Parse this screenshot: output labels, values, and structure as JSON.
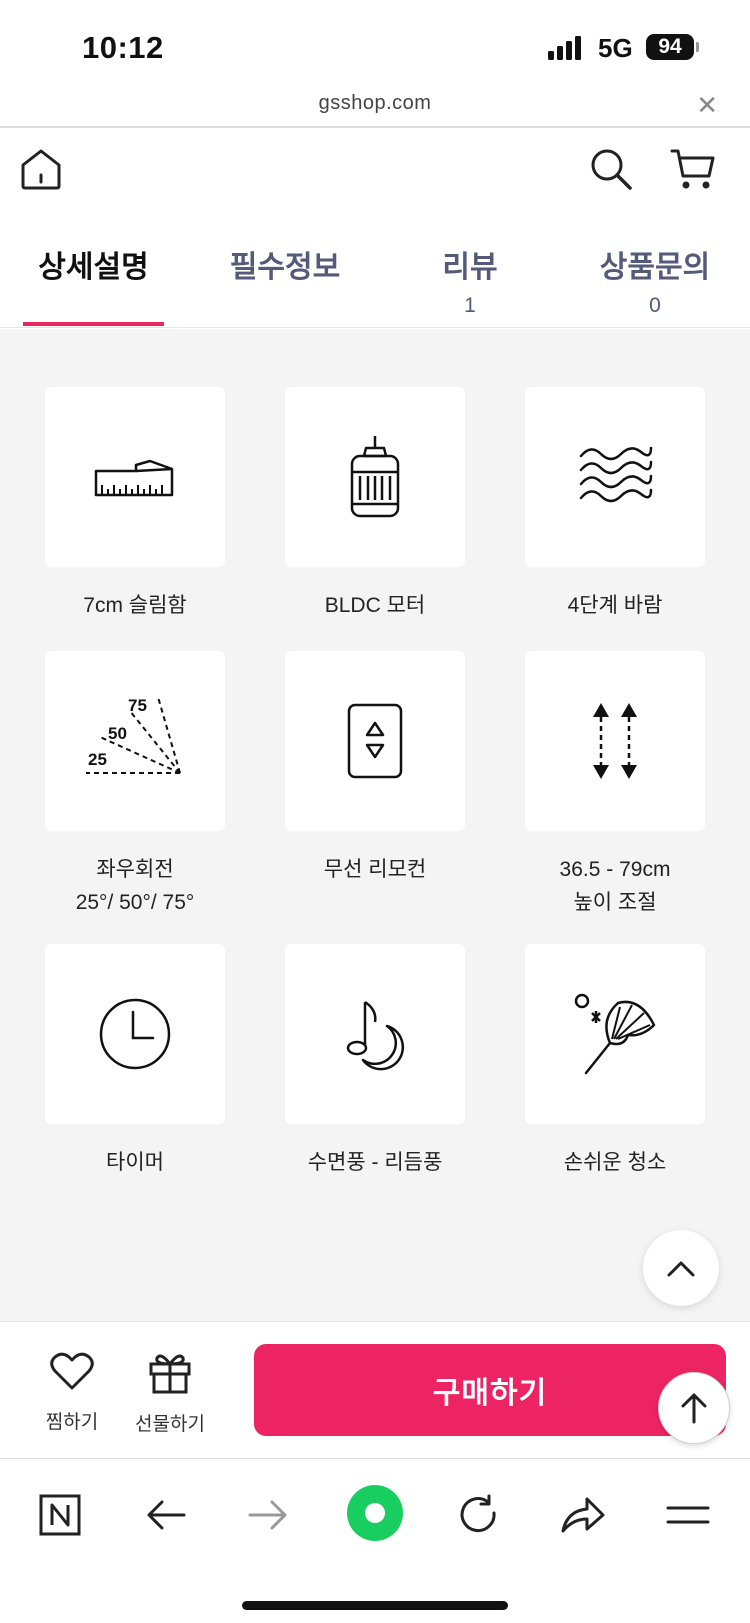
{
  "status": {
    "time": "10:12",
    "network": "5G",
    "battery": "94"
  },
  "browser": {
    "url": "gsshop.com"
  },
  "tabs": [
    {
      "label": "상세설명",
      "count": ""
    },
    {
      "label": "필수정보",
      "count": ""
    },
    {
      "label": "리뷰",
      "count": "1"
    },
    {
      "label": "상품문의",
      "count": "0"
    }
  ],
  "features": [
    {
      "icon": "ruler-icon",
      "line1": "7cm 슬림함",
      "line2": ""
    },
    {
      "icon": "motor-icon",
      "line1": "BLDC 모터",
      "line2": ""
    },
    {
      "icon": "wind-waves-icon",
      "line1": "4단계 바람",
      "line2": ""
    },
    {
      "icon": "rotation-angle-icon",
      "line1": "좌우회전",
      "line2": "25°/ 50°/ 75°"
    },
    {
      "icon": "remote-control-icon",
      "line1": "무선 리모컨",
      "line2": ""
    },
    {
      "icon": "height-arrows-icon",
      "line1": "36.5 - 79cm",
      "line2": "높이 조절"
    },
    {
      "icon": "timer-clock-icon",
      "line1": "타이머",
      "line2": ""
    },
    {
      "icon": "music-moon-icon",
      "line1": "수면풍 - 리듬풍",
      "line2": ""
    },
    {
      "icon": "cleaning-brush-icon",
      "line1": "손쉬운 청소",
      "line2": ""
    }
  ],
  "angle_labels": [
    "75",
    "50",
    "25"
  ],
  "actions": {
    "wish": "찜하기",
    "gift": "선물하기",
    "buy": "구매하기"
  },
  "colors": {
    "accent": "#ed2463",
    "tab_inactive": "#555a7a",
    "content_bg": "#f4f4f4"
  }
}
